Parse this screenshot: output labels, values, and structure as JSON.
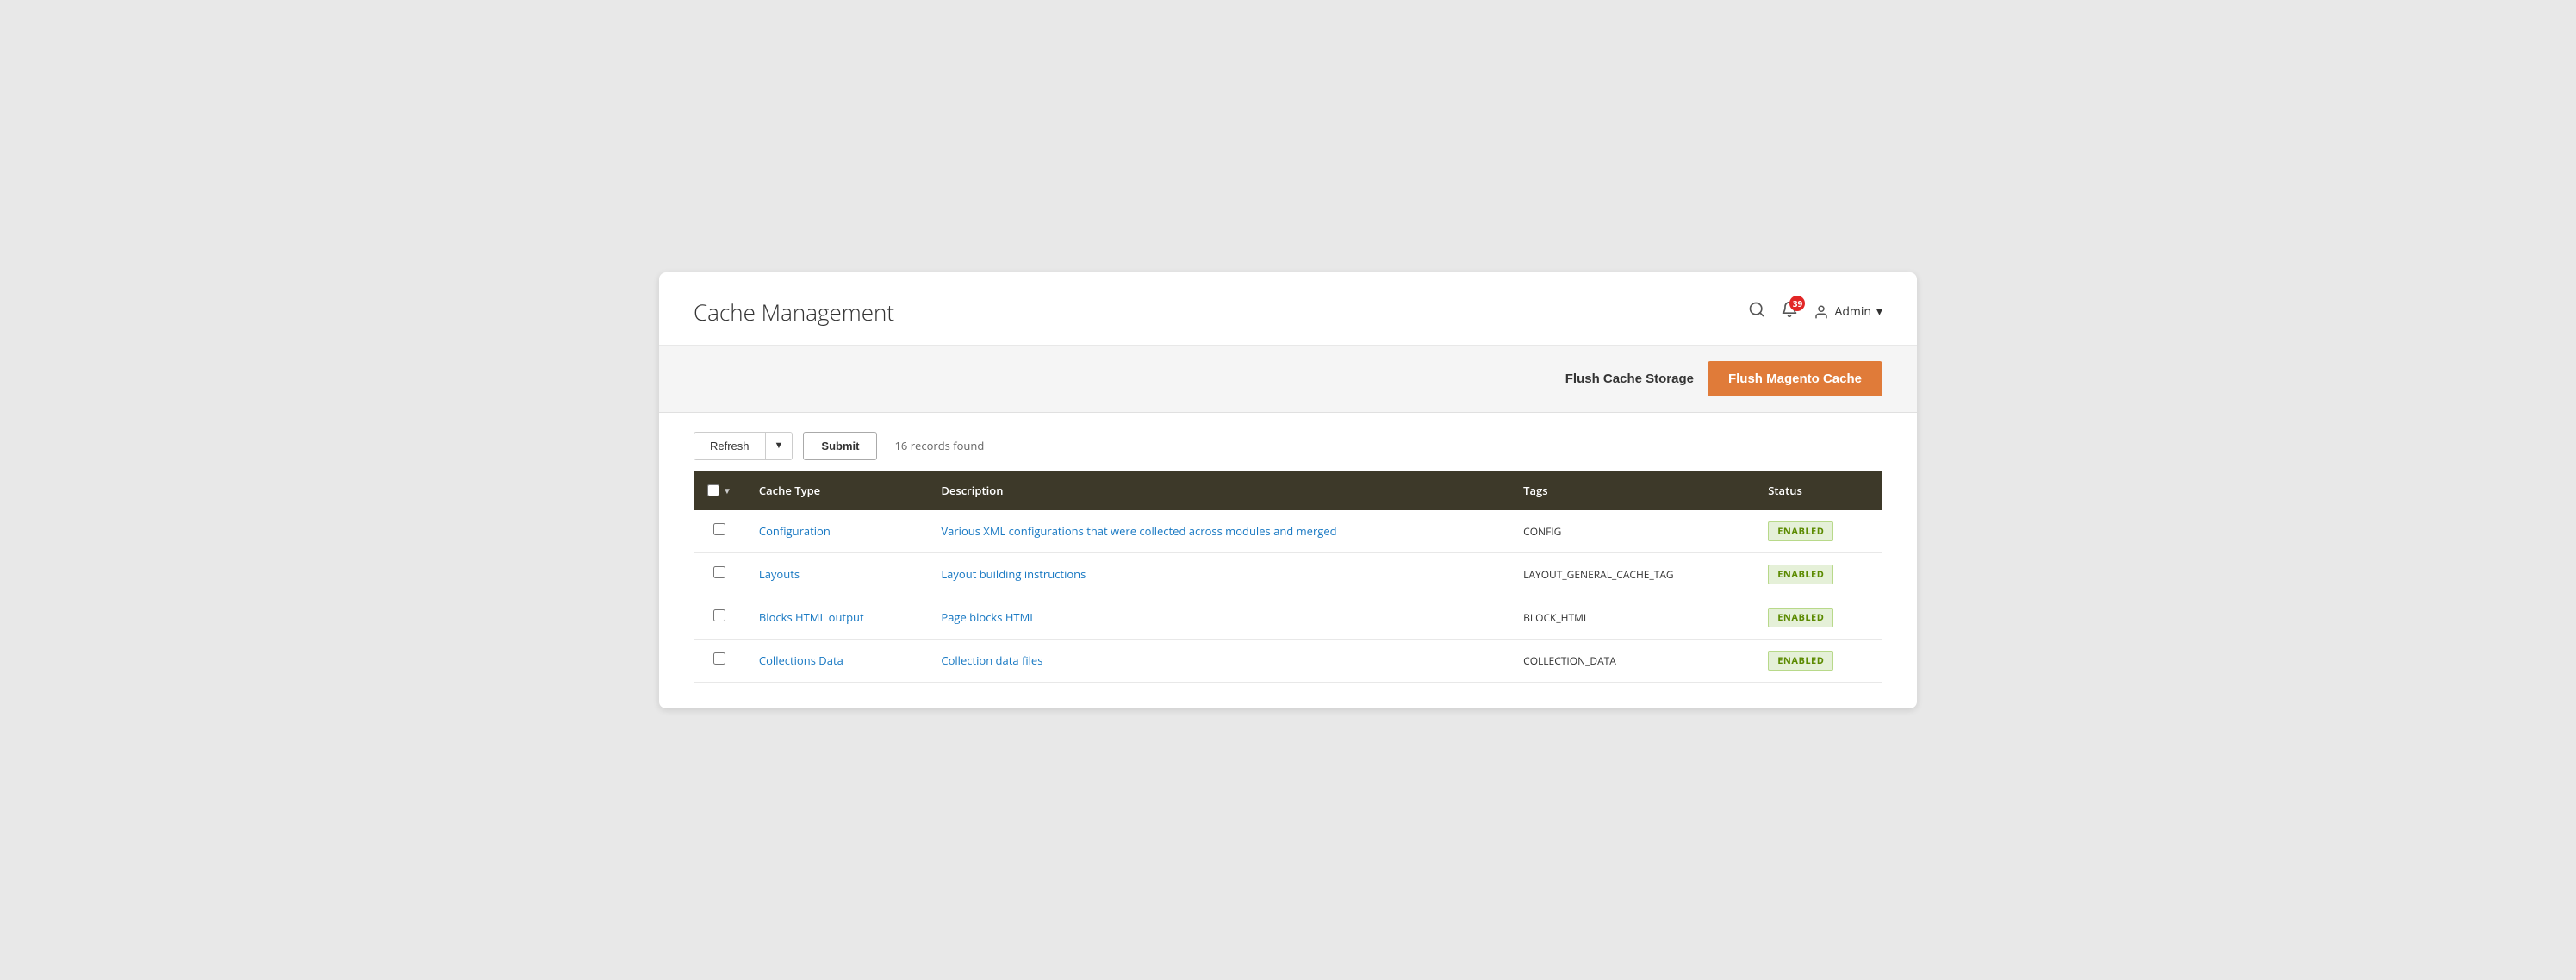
{
  "page": {
    "title": "Cache Management"
  },
  "header": {
    "search_icon": "🔍",
    "bell_icon": "🔔",
    "notification_count": "39",
    "admin_label": "Admin",
    "admin_arrow": "▾"
  },
  "action_bar": {
    "flush_storage_label": "Flush Cache Storage",
    "flush_magento_label": "Flush Magento Cache"
  },
  "toolbar": {
    "refresh_label": "Refresh",
    "submit_label": "Submit",
    "records_found": "16 records found"
  },
  "table": {
    "columns": [
      {
        "key": "checkbox",
        "label": ""
      },
      {
        "key": "cache_type",
        "label": "Cache Type"
      },
      {
        "key": "description",
        "label": "Description"
      },
      {
        "key": "tags",
        "label": "Tags"
      },
      {
        "key": "status",
        "label": "Status"
      }
    ],
    "rows": [
      {
        "cache_type": "Configuration",
        "description": "Various XML configurations that were collected across modules and merged",
        "tags": "CONFIG",
        "status": "ENABLED",
        "status_class": "status-enabled"
      },
      {
        "cache_type": "Layouts",
        "description": "Layout building instructions",
        "tags": "LAYOUT_GENERAL_CACHE_TAG",
        "status": "ENABLED",
        "status_class": "status-enabled"
      },
      {
        "cache_type": "Blocks HTML output",
        "description": "Page blocks HTML",
        "tags": "BLOCK_HTML",
        "status": "ENABLED",
        "status_class": "status-enabled"
      },
      {
        "cache_type": "Collections Data",
        "description": "Collection data files",
        "tags": "COLLECTION_DATA",
        "status": "ENABLED",
        "status_class": "status-enabled"
      }
    ]
  }
}
